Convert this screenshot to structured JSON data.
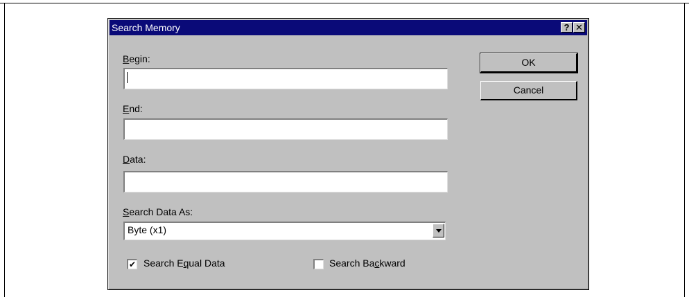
{
  "dialog": {
    "title": "Search Memory",
    "help_label": "?",
    "close_label": "✕"
  },
  "fields": {
    "begin": {
      "label_mnemonic": "B",
      "label_rest": "egin:",
      "value": ""
    },
    "end": {
      "label_mnemonic": "E",
      "label_rest": "nd:",
      "value": ""
    },
    "data": {
      "label_mnemonic": "D",
      "label_rest": "ata:",
      "value": ""
    }
  },
  "search_as": {
    "label_mnemonic": "S",
    "label_rest": "earch Data As:",
    "selected": "Byte (x1)"
  },
  "buttons": {
    "ok": "OK",
    "cancel": "Cancel"
  },
  "options": {
    "equal": {
      "label_pre": "Search E",
      "label_mnemonic": "q",
      "label_post": "ual Data",
      "checked": true,
      "mark": "✔"
    },
    "backward": {
      "label_pre": "Search Ba",
      "label_mnemonic": "c",
      "label_post": "kward",
      "checked": false
    }
  }
}
